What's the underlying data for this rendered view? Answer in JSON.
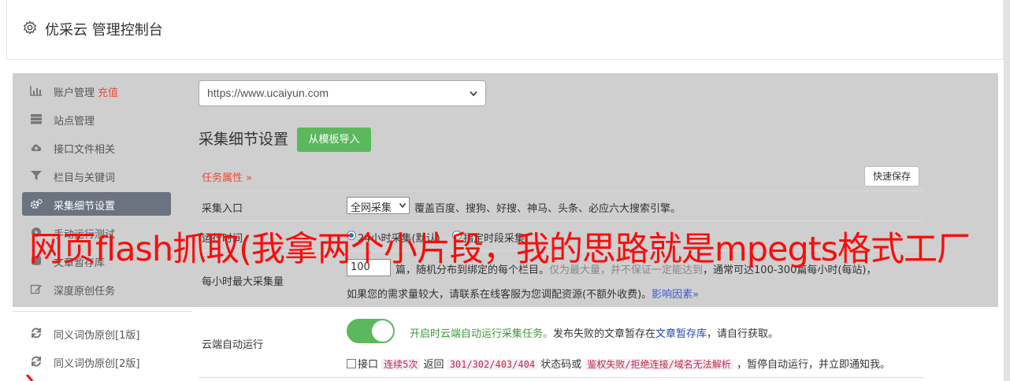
{
  "header": {
    "title": "优采云 管理控制台"
  },
  "sidebar": {
    "items": [
      {
        "label": "账户管理",
        "badge": "充值",
        "icon": "bar-chart-icon"
      },
      {
        "label": "站点管理",
        "icon": "server-icon"
      },
      {
        "label": "接口文件相关",
        "icon": "cloud-upload-icon"
      },
      {
        "label": "栏目与关键词",
        "icon": "filter-icon"
      },
      {
        "label": "采集细节设置",
        "icon": "cogs-icon",
        "active": true
      },
      {
        "label": "手动运行测试",
        "icon": "play-icon"
      },
      {
        "label": "文章暂存库",
        "icon": "database-icon"
      },
      {
        "label": "深度原创任务",
        "icon": "edit-icon"
      }
    ],
    "lower_items": [
      {
        "label": "同义词伪原创[1版]",
        "icon": "refresh-icon"
      },
      {
        "label": "同义词伪原创[2版]",
        "icon": "refresh-icon"
      }
    ]
  },
  "main": {
    "site_select": {
      "value": "https://www.ucaiyun.com"
    },
    "section_title": "采集细节设置",
    "template_button": "从模板导入",
    "task_attr": {
      "label": "任务属性 »",
      "quick_save": "快速保存"
    },
    "entry": {
      "label": "采集入口",
      "select_value": "全网采集",
      "desc": "覆盖百度、搜狗、好搜、神马、头条、必应六大搜索引擎。"
    },
    "runtime": {
      "label": "运行时间",
      "option1": "24小时采集(默认)",
      "option2": "指定时段采集"
    },
    "max_per_hour": {
      "label": "每小时最大采集量",
      "value": "100",
      "line1_a": "篇，随机分布到绑定的每个栏目。",
      "line1_b": "仅为最大量，并不保证一定能达到",
      "line1_c": "，通常可达100-300篇每小时(每站)，",
      "line2_a": "如果您的需求量较大，请联系在线客服为您调配资源(不额外收费)。",
      "line2_link": "影响因素»"
    },
    "cloud": {
      "label": "云端自动运行",
      "toggle_on": true,
      "desc_green": "开启时云端自动运行采集任务。",
      "desc_a": "发布失败的文章暂存在",
      "desc_link": "文章暂存库",
      "desc_b": "，请自行获取。",
      "line2_a": "接口",
      "tag1": "连续5次",
      "line2_b": "返回",
      "tag2": "301/302/403/404",
      "line2_c": "状态码或",
      "tag3": "鉴权失败/拒绝连接/域名无法解析",
      "line2_d": "，暂停自动运行，并立即通知我。"
    }
  },
  "overlay_text": "网页flash抓取(我拿两个小片段，我的思路就是mpegts格式工厂"
}
